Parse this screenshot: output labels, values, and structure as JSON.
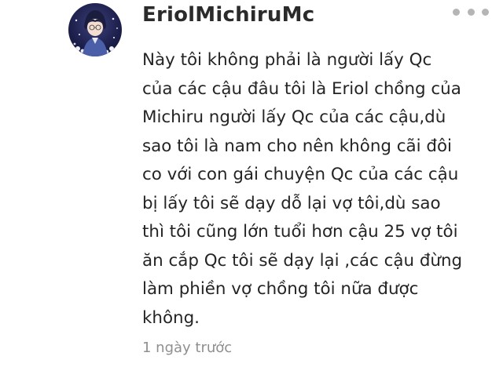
{
  "comment": {
    "username": "EriolMichiruMc",
    "avatar_icon": "anime-character-avatar",
    "more_icon": "more-dots-icon",
    "text_lines": [
      "Này tôi không phải là người lấy Qc",
      "của các cậu đâu tôi là Eriol chồng của",
      "Michiru người lấy Qc của các cậu,dù",
      "sao tôi là nam cho nên không cãi đôi",
      "co với con gái chuyện Qc của các cậu",
      "bị lấy tôi sẽ dạy dỗ lại vợ tôi,dù sao",
      "thì tôi cũng lớn tuổi hơn cậu 25 vợ tôi",
      "ăn cắp Qc tôi sẽ dạy lại ,các cậu đừng",
      "làm phiền vợ chồng tôi nữa được",
      "không."
    ],
    "timestamp": "1 ngày trước"
  }
}
